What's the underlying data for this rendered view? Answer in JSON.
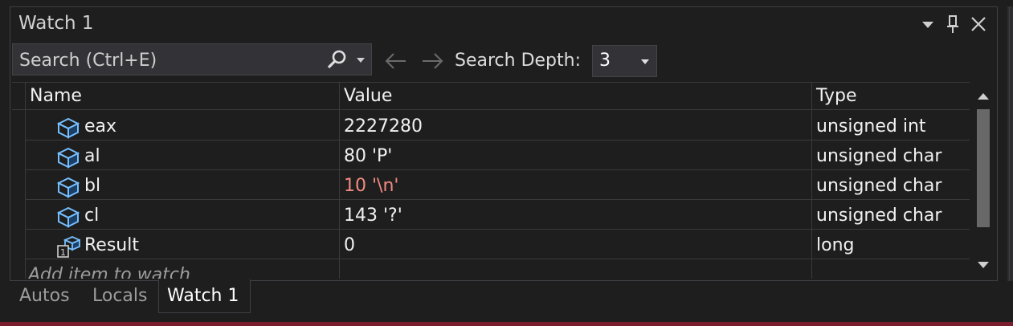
{
  "window": {
    "title": "Watch 1"
  },
  "toolbar": {
    "search_placeholder": "Search (Ctrl+E)",
    "search_depth_label": "Search Depth:",
    "search_depth_value": "3"
  },
  "columns": [
    "Name",
    "Value",
    "Type"
  ],
  "rows": [
    {
      "name": "eax",
      "value": "2227280",
      "type": "unsigned int",
      "icon": "variable-box-icon",
      "changed": false
    },
    {
      "name": "al",
      "value": "80 'P'",
      "type": "unsigned char",
      "icon": "variable-box-icon",
      "changed": false
    },
    {
      "name": "bl",
      "value": "10 '\\n'",
      "type": "unsigned char",
      "icon": "variable-box-icon",
      "changed": true
    },
    {
      "name": "cl",
      "value": "143 '?'",
      "type": "unsigned char",
      "icon": "variable-box-icon",
      "changed": false
    },
    {
      "name": "Result",
      "value": "0",
      "type": "long",
      "icon": "return-value-icon",
      "changed": false
    }
  ],
  "add_item_placeholder": "Add item to watch",
  "tabs": [
    {
      "label": "Autos",
      "active": false
    },
    {
      "label": "Locals",
      "active": false
    },
    {
      "label": "Watch 1",
      "active": true
    }
  ],
  "colors": {
    "background": "#1e1e1e",
    "changed_value": "#f28b82",
    "icon_accent": "#75beff",
    "accent_bar": "#7a1d2e"
  }
}
